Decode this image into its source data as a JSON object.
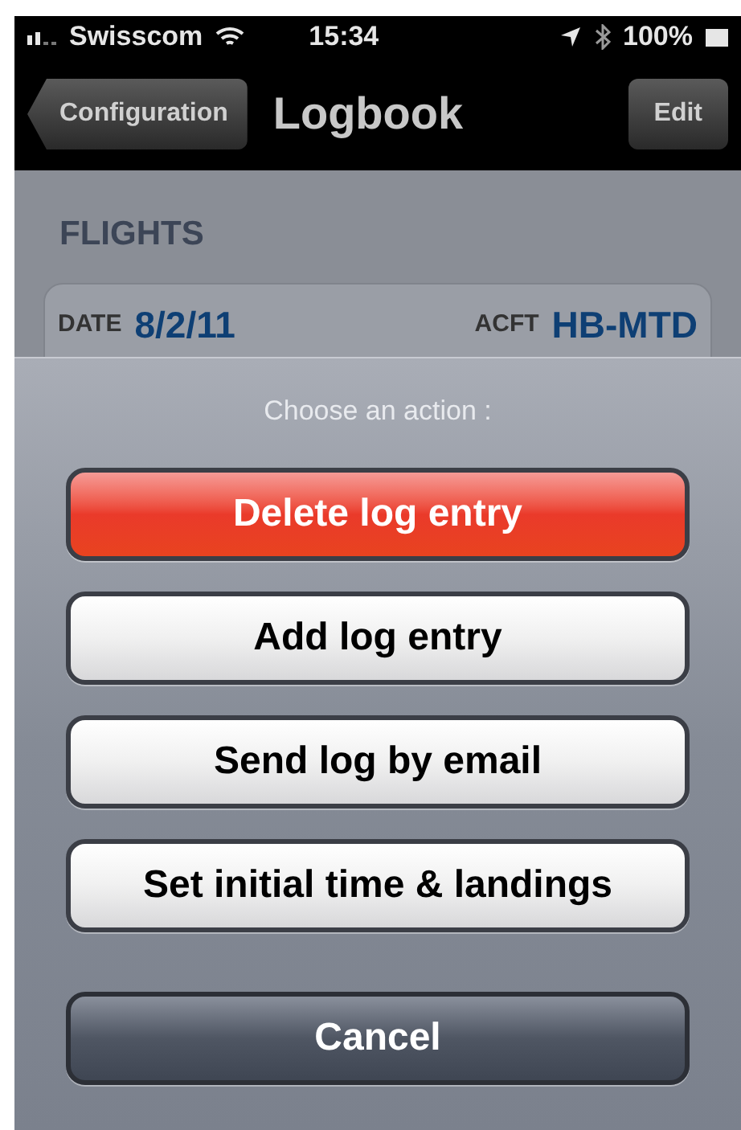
{
  "status_bar": {
    "carrier": "Swisscom",
    "time": "15:34",
    "battery": "100%"
  },
  "nav_bar": {
    "back": "Configuration",
    "title": "Logbook",
    "action": "Edit"
  },
  "section": {
    "title": "FLIGHTS"
  },
  "entry": {
    "date_label": "DATE",
    "date": "8/2/11",
    "aircraft_label": "ACFT",
    "aircraft": "HB-MTD"
  },
  "action_sheet": {
    "title": "Choose an action :",
    "buttons": [
      {
        "label": "Delete log entry",
        "kind": "destructive"
      },
      {
        "label": "Add log entry",
        "kind": "default"
      },
      {
        "label": "Send log by email",
        "kind": "default"
      },
      {
        "label": "Set initial time & landings",
        "kind": "default"
      },
      {
        "label": "Cancel",
        "kind": "cancel"
      }
    ]
  }
}
